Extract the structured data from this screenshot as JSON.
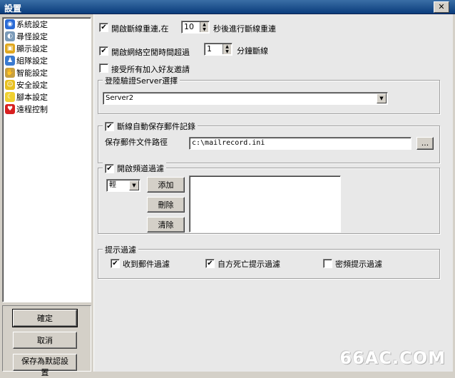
{
  "window": {
    "title": "設置",
    "close_icon": "close-icon",
    "close_glyph": "✕"
  },
  "sidebar": {
    "items": [
      {
        "label": "系統設定",
        "icon": "system-icon",
        "color": "#2a6bd6",
        "glyph": "◉"
      },
      {
        "label": "尋怪設定",
        "icon": "search-monster-icon",
        "color": "#7a9ab8",
        "glyph": "◐"
      },
      {
        "label": "顯示設定",
        "icon": "display-icon",
        "color": "#e0a820",
        "glyph": "▣"
      },
      {
        "label": "組隊設定",
        "icon": "team-icon",
        "color": "#3a7ad0",
        "glyph": "♟"
      },
      {
        "label": "智能設定",
        "icon": "smart-icon",
        "color": "#c8a040",
        "glyph": "✋"
      },
      {
        "label": "安全設定",
        "icon": "security-icon",
        "color": "#e8c020",
        "glyph": "☺"
      },
      {
        "label": "腳本設定",
        "icon": "script-icon",
        "color": "#f0d030",
        "glyph": "☾"
      },
      {
        "label": "遠程控制",
        "icon": "remote-icon",
        "color": "#d82020",
        "glyph": "♥"
      }
    ]
  },
  "buttons": {
    "ok": "確定",
    "cancel": "取消",
    "save_default": "保存為默認設置"
  },
  "reconnect": {
    "checked": true,
    "label_before": "開啟斷線重連,在",
    "value": "10",
    "label_after": "秒後進行斷線重連"
  },
  "idle": {
    "checked": true,
    "label_before": "開啟網絡空閒時間超過",
    "value": "1",
    "label_after": "分鐘斷線"
  },
  "friend": {
    "checked": false,
    "label": "接受所有加入好友邀請"
  },
  "server": {
    "group_title": "登陸驗證Server選擇",
    "selected": "Server2"
  },
  "mail": {
    "checked": true,
    "group_title": "斷線自動保存郵件記錄",
    "path_label": "保存郵件文件路徑",
    "path_value": "c:\\mailrecord.ini",
    "browse": "..."
  },
  "channel": {
    "checked": true,
    "group_title": "開啟頻道過濾",
    "selected": "輕",
    "add": "添加",
    "delete": "刪除",
    "clear": "清除"
  },
  "hint": {
    "group_title": "提示過濾",
    "options": [
      {
        "checked": true,
        "label": "收到郵件過濾"
      },
      {
        "checked": true,
        "label": "自方死亡提示過濾"
      },
      {
        "checked": false,
        "label": "密頻提示過濾"
      }
    ]
  },
  "checkmark": "✔",
  "arrows": {
    "up": "▲",
    "down": "▼"
  },
  "watermark": "66AC.COM"
}
